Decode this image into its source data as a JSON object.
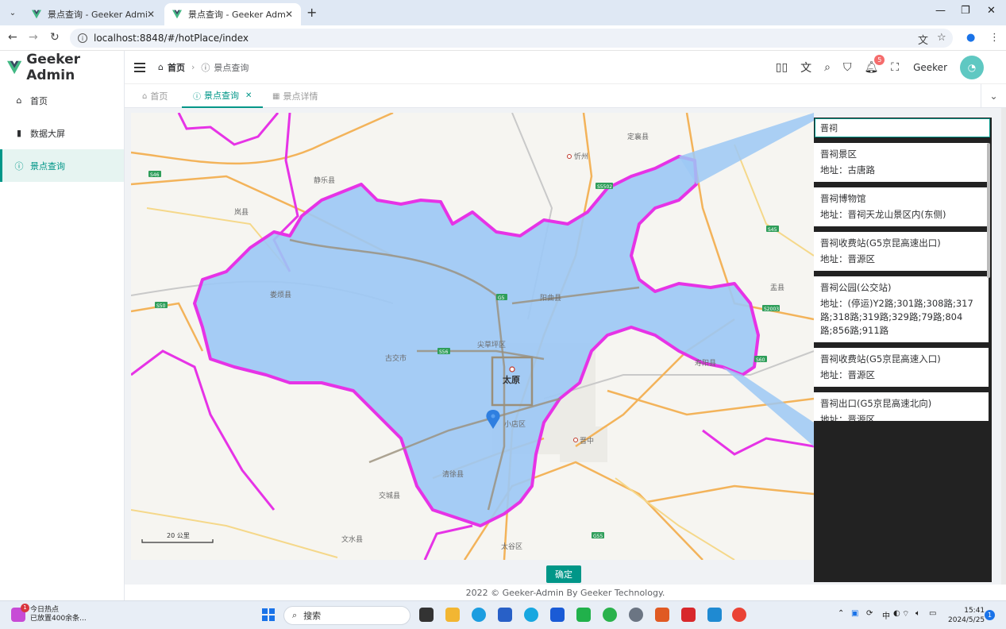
{
  "browser": {
    "tabs": [
      {
        "title": "景点查询 - Geeker Admin",
        "active": false
      },
      {
        "title": "景点查询 - Geeker Admin",
        "active": true
      }
    ],
    "url": "localhost:8848/#/hotPlace/index"
  },
  "app": {
    "logo_text": "Geeker Admin",
    "menu": [
      {
        "label": "首页",
        "icon": "home-icon",
        "active": false
      },
      {
        "label": "数据大屏",
        "icon": "bar-chart-icon",
        "active": false
      },
      {
        "label": "景点查询",
        "icon": "info-icon",
        "active": true
      }
    ],
    "breadcrumb": {
      "home": "首页",
      "current": "景点查询"
    },
    "header": {
      "username": "Geeker",
      "notification_count": "5"
    },
    "page_tabs": [
      {
        "label": "首页",
        "icon": "home-icon",
        "active": false
      },
      {
        "label": "景点查询",
        "icon": "info-icon",
        "active": true
      },
      {
        "label": "景点详情",
        "icon": "grid-icon",
        "active": false
      }
    ],
    "confirm_label": "确定",
    "footer": "2022 © Geeker-Admin By Geeker Technology."
  },
  "map": {
    "place_labels": {
      "taiyuan": "太原",
      "xinzhou": "忻州",
      "dingxiang": "定襄县",
      "jingle": "静乐县",
      "lan": "岚县",
      "loufan": "娄烦县",
      "yangqu": "阳曲县",
      "jiancaoping": "尖草坪区",
      "gujiao": "古交市",
      "xiaodian": "小店区",
      "qingxu": "清徐县",
      "jiaocheng": "交城县",
      "wenshui": "文水县",
      "taigu": "太谷区",
      "jinzhong": "晋中",
      "shouyang": "寿阳县",
      "yu": "盂县"
    },
    "road_shields": [
      "S46",
      "S5502",
      "S45",
      "S50",
      "G5",
      "S56",
      "S2003",
      "G55",
      "S60"
    ],
    "scale_label": "20 公里"
  },
  "search": {
    "value": "晋祠",
    "results": [
      {
        "name": "晋祠景区",
        "address": "地址：古唐路"
      },
      {
        "name": "晋祠博物馆",
        "address": "地址：晋祠天龙山景区内(东侧)"
      },
      {
        "name": "晋祠收费站(G5京昆高速出口)",
        "address": "地址：晋源区"
      },
      {
        "name": "晋祠公园(公交站)",
        "address": "地址：(停运)Y2路;301路;308路;317路;318路;319路;329路;79路;804路;856路;911路"
      },
      {
        "name": "晋祠收费站(G5京昆高速入口)",
        "address": "地址：晋源区"
      },
      {
        "name": "晋祠出口(G5京昆高速北向)",
        "address": "地址：晋源区"
      }
    ]
  },
  "taskbar": {
    "news_title": "今日热点",
    "news_sub": "已放置400余条...",
    "news_badge": "1",
    "search_placeholder": "搜索",
    "ime": "中",
    "time": "15:41",
    "date": "2024/5/25",
    "notify_count": "1"
  },
  "colors": {
    "accent": "#009688",
    "boundary": "#e633e6",
    "region_fill": "#9cc8f5"
  }
}
